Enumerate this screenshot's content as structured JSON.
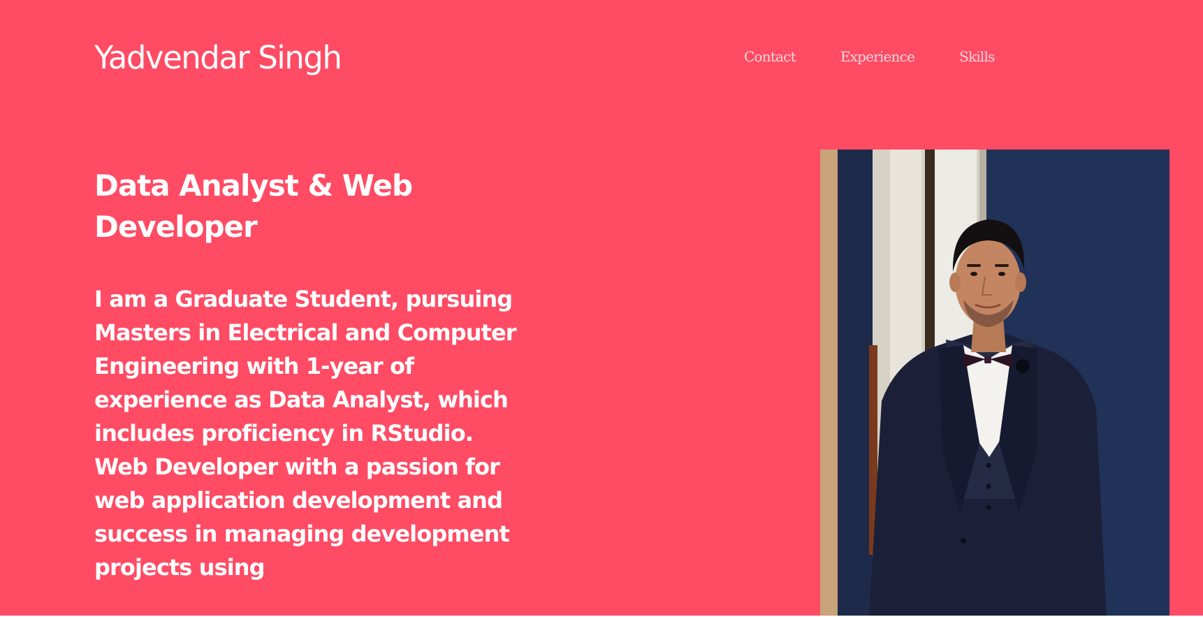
{
  "header": {
    "brand": "Yadvendar Singh",
    "nav": [
      {
        "label": "Contact"
      },
      {
        "label": "Experience"
      },
      {
        "label": "Skills"
      }
    ]
  },
  "hero": {
    "headline": "Data Analyst & Web Developer",
    "bio": "I am a Graduate Student, pursuing Masters in Electrical and Computer Engineering with 1-year of experience as Data Analyst, which includes proficiency in RStudio. Web Developer with a passion for web application development and success in managing development projects using"
  },
  "colors": {
    "background": "#ff4b64",
    "text": "#ffffff",
    "nav_text": "#f2d7dc"
  },
  "profile_photo": {
    "subject": "young man in dark navy three-piece suit with bow tie"
  }
}
